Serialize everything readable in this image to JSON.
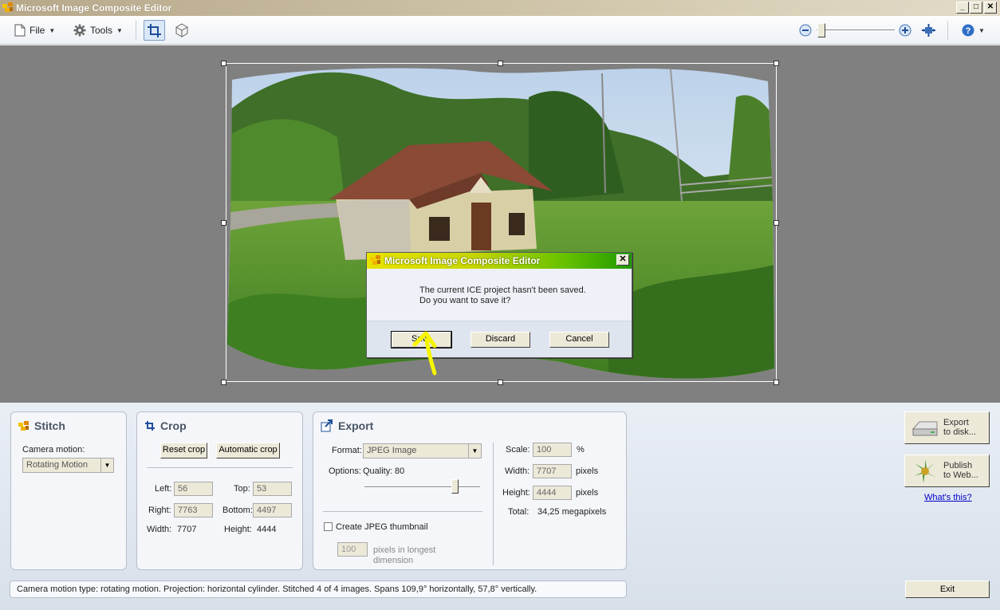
{
  "window": {
    "title": "Microsoft Image Composite Editor",
    "minimize": "_",
    "maximize": "□",
    "close": "✕"
  },
  "toolbar": {
    "file_label": "File",
    "tools_label": "Tools"
  },
  "dialog": {
    "title": "Microsoft Image Composite Editor",
    "message_line1": "The current ICE project hasn't been saved.",
    "message_line2": "Do you want to save it?",
    "save_label": "Save",
    "discard_label": "Discard",
    "cancel_label": "Cancel",
    "close": "✕"
  },
  "stitch": {
    "title": "Stitch",
    "camera_motion_label": "Camera motion:",
    "camera_motion_value": "Rotating Motion"
  },
  "crop": {
    "title": "Crop",
    "reset_label": "Reset crop",
    "auto_label": "Automatic crop",
    "left_label": "Left:",
    "left_value": "56",
    "top_label": "Top:",
    "top_value": "53",
    "right_label": "Right:",
    "right_value": "7763",
    "bottom_label": "Bottom:",
    "bottom_value": "4497",
    "width_label": "Width:",
    "width_value": "7707",
    "height_label": "Height:",
    "height_value": "4444"
  },
  "export": {
    "title": "Export",
    "format_label": "Format:",
    "format_value": "JPEG Image",
    "options_label": "Options:",
    "quality_label": "Quality:",
    "quality_value": "80",
    "quality_fraction": 0.8,
    "thumbnail_label": "Create JPEG thumbnail",
    "thumb_size": "100",
    "thumb_unit_line1": "pixels in longest",
    "thumb_unit_line2": "dimension",
    "scale_label": "Scale:",
    "scale_value": "100",
    "scale_unit": "%",
    "width_label": "Width:",
    "width_value": "7707",
    "height_label": "Height:",
    "height_value": "4444",
    "pixels_unit": "pixels",
    "total_label": "Total:",
    "total_value": "34,25 megapixels"
  },
  "actions": {
    "export_disk_line1": "Export",
    "export_disk_line2": "to disk...",
    "publish_web_line1": "Publish",
    "publish_web_line2": "to Web...",
    "whats_this": "What's this?",
    "exit_label": "Exit"
  },
  "status": {
    "text": "Camera motion type: rotating motion. Projection: horizontal cylinder. Stitched 4 of 4 images. Spans 109,9° horizontally, 57,8° vertically."
  },
  "colors": {
    "annotation_arrow": "#f5f500",
    "dialog_title_start": "#e8e400",
    "dialog_title_end": "#1f9a00",
    "preview_bg": "#808080"
  }
}
